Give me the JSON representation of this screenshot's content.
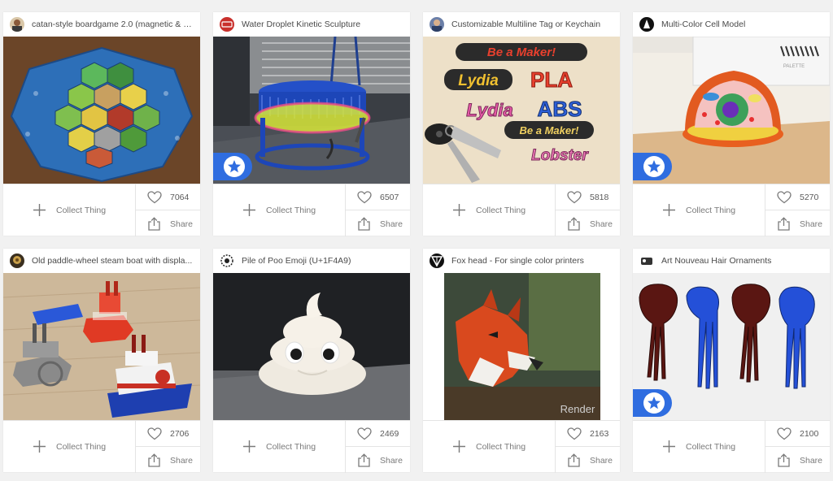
{
  "cards": [
    {
      "title": "catan-style boardgame 2.0 (magnetic & m...",
      "likes": "7064",
      "featured": false,
      "collect_label": "Collect Thing",
      "share_label": "Share"
    },
    {
      "title": "Water Droplet Kinetic Sculpture",
      "likes": "6507",
      "featured": true,
      "collect_label": "Collect Thing",
      "share_label": "Share"
    },
    {
      "title": "Customizable Multiline Tag or Keychain",
      "likes": "5818",
      "featured": false,
      "collect_label": "Collect Thing",
      "share_label": "Share",
      "image_text": [
        "Be a Maker!",
        "Lydia",
        "PLA",
        "Lydia",
        "ABS",
        "Be a Maker!",
        "Lobster"
      ]
    },
    {
      "title": "Multi-Color Cell Model",
      "likes": "5270",
      "featured": true,
      "collect_label": "Collect Thing",
      "share_label": "Share",
      "image_text": "PALETTE"
    },
    {
      "title": "Old paddle-wheel steam boat with displa...",
      "likes": "2706",
      "featured": false,
      "collect_label": "Collect Thing",
      "share_label": "Share"
    },
    {
      "title": "Pile of Poo Emoji (U+1F4A9)",
      "likes": "2469",
      "featured": false,
      "collect_label": "Collect Thing",
      "share_label": "Share"
    },
    {
      "title": "Fox head - For single color printers",
      "likes": "2163",
      "featured": false,
      "collect_label": "Collect Thing",
      "share_label": "Share",
      "image_text": "Render"
    },
    {
      "title": "Art Nouveau Hair Ornaments",
      "likes": "2100",
      "featured": true,
      "collect_label": "Collect Thing",
      "share_label": "Share"
    }
  ],
  "colors": {
    "featured_badge": "#2f6de0",
    "page_background": "#f1f1f1"
  },
  "icons": {
    "collect": "plus-icon",
    "like": "heart-icon",
    "share": "share-icon",
    "featured": "star-icon"
  }
}
